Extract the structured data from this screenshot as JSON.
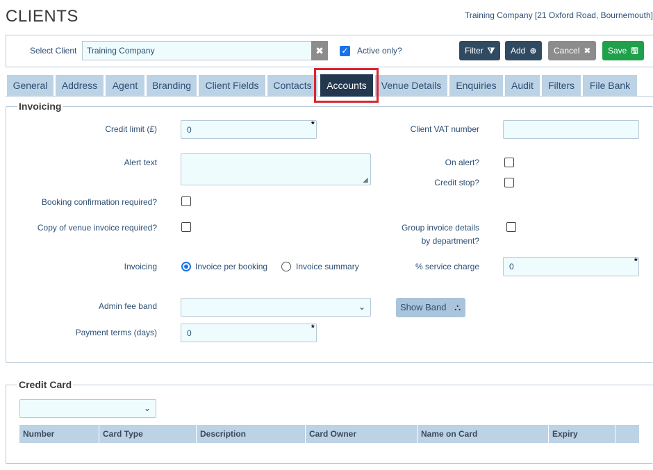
{
  "page": {
    "title": "CLIENTS",
    "company_ref": "Training Company [21 Oxford Road, Bournemouth]"
  },
  "client_bar": {
    "select_label": "Select Client",
    "client_value": "Training Company",
    "clear_icon": "✖",
    "active_only_label": "Active only?",
    "active_only_checked": true,
    "buttons": {
      "filter": "Filter",
      "add": "Add",
      "cancel": "Cancel",
      "save": "Save"
    }
  },
  "tabs": [
    {
      "label": "General"
    },
    {
      "label": "Address"
    },
    {
      "label": "Agent"
    },
    {
      "label": "Branding"
    },
    {
      "label": "Client Fields"
    },
    {
      "label": "Contacts"
    },
    {
      "label": "Accounts"
    },
    {
      "label": "Venue Details"
    },
    {
      "label": "Enquiries"
    },
    {
      "label": "Audit"
    },
    {
      "label": "Filters"
    },
    {
      "label": "File Bank"
    }
  ],
  "active_tab": "Accounts",
  "invoicing": {
    "legend": "Invoicing",
    "credit_limit_label": "Credit limit (£)",
    "credit_limit_value": "0",
    "client_vat_label": "Client VAT number",
    "client_vat_value": "",
    "alert_text_label": "Alert text",
    "alert_text_value": "",
    "on_alert_label": "On alert?",
    "credit_stop_label": "Credit stop?",
    "booking_conf_label": "Booking confirmation required?",
    "copy_venue_invoice_label": "Copy of venue invoice required?",
    "group_invoice_label_1": "Group invoice details",
    "group_invoice_label_2": "by department?",
    "invoicing_label": "Invoicing",
    "invoice_per_booking": "Invoice per booking",
    "invoice_summary": "Invoice summary",
    "invoicing_selected": "Invoice per booking",
    "service_charge_label": "% service charge",
    "service_charge_value": "0",
    "admin_fee_label": "Admin fee band",
    "admin_fee_value": "",
    "show_band_label": "Show Band",
    "payment_terms_label": "Payment terms (days)",
    "payment_terms_value": "0",
    "required_marker": "*"
  },
  "credit_card": {
    "legend": "Credit Card",
    "select_value": "",
    "columns": [
      "Number",
      "Card Type",
      "Description",
      "Card Owner",
      "Name on Card",
      "Expiry"
    ]
  },
  "colors": {
    "accent": "#304a61",
    "tab_bg": "#bcd2e5",
    "tab_active": "#23384e",
    "save_green": "#1ea14a",
    "highlight_red": "#d9262e",
    "field_bg": "#eefcfd"
  }
}
